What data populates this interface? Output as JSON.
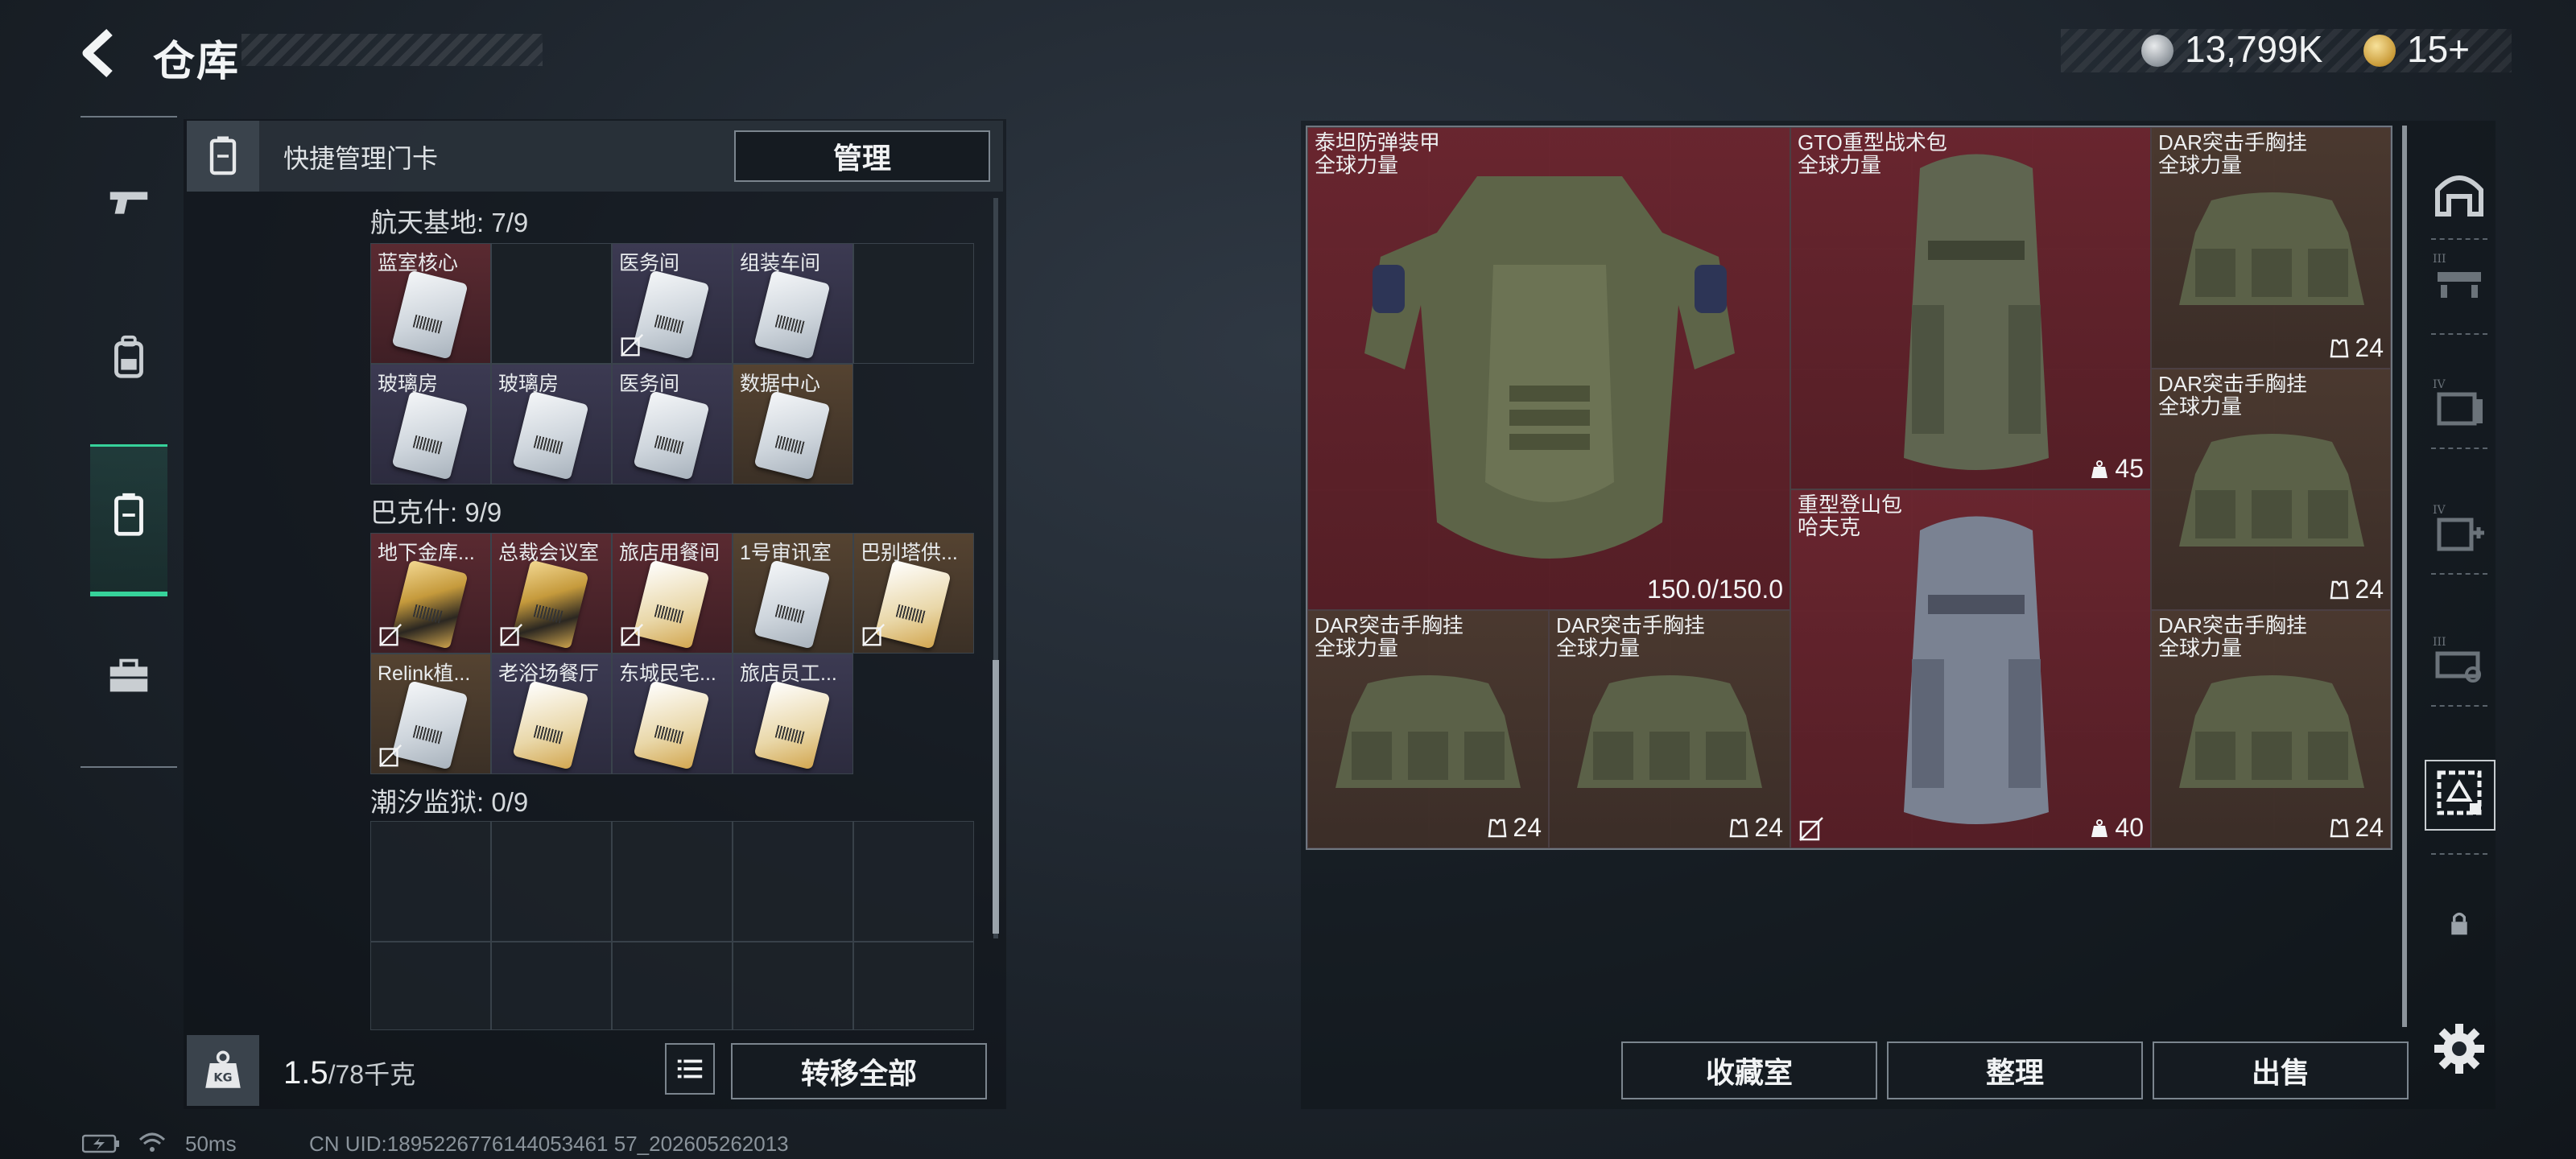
{
  "header": {
    "title": "仓库",
    "currency_silver": "13,799K",
    "currency_gold": "15+"
  },
  "sidebar": {
    "items": [
      {
        "name": "pistol",
        "icon": "pistol-icon"
      },
      {
        "name": "backpack",
        "icon": "backpack-icon"
      },
      {
        "name": "keycard",
        "icon": "keycard-icon",
        "active": true
      },
      {
        "name": "toolbox",
        "icon": "toolbox-icon"
      }
    ]
  },
  "left_panel": {
    "quick_manage_label": "快捷管理门卡",
    "manage_button": "管理",
    "sections": [
      {
        "label": "航天基地: 7/9",
        "cells": [
          {
            "name": "蓝室核心",
            "color": "red",
            "card": "white"
          },
          {
            "name": "",
            "color": "blank"
          },
          {
            "name": "医务间",
            "color": "purple",
            "card": "white",
            "unlinked": true
          },
          {
            "name": "组装车间",
            "color": "purple",
            "card": "white"
          },
          {
            "name": "",
            "color": "blank"
          },
          {
            "name": "玻璃房",
            "color": "purple",
            "card": "white"
          },
          {
            "name": "玻璃房",
            "color": "purple",
            "card": "white"
          },
          {
            "name": "医务间",
            "color": "purple",
            "card": "white"
          },
          {
            "name": "数据中心",
            "color": "gold",
            "card": "white"
          }
        ]
      },
      {
        "label": "巴克什: 9/9",
        "cells": [
          {
            "name": "地下金库...",
            "color": "red",
            "card": "gold",
            "unlinked": true
          },
          {
            "name": "总裁会议室",
            "color": "red",
            "card": "gold",
            "unlinked": true
          },
          {
            "name": "旅店用餐间",
            "color": "red",
            "card": "amber",
            "unlinked": true
          },
          {
            "name": "1号审讯室",
            "color": "gold",
            "card": "white"
          },
          {
            "name": "巴别塔供...",
            "color": "gold",
            "card": "amber",
            "unlinked": true
          },
          {
            "name": "Relink植...",
            "color": "gold",
            "card": "white",
            "unlinked": true
          },
          {
            "name": "老浴场餐厅",
            "color": "purple",
            "card": "amber"
          },
          {
            "name": "东城民宅...",
            "color": "purple",
            "card": "amber"
          },
          {
            "name": "旅店员工...",
            "color": "purple",
            "card": "amber"
          }
        ]
      },
      {
        "label": "潮汐监狱: 0/9",
        "cells": []
      }
    ],
    "weight_current": "1.5",
    "weight_max": "/78千克",
    "transfer_all_button": "转移全部"
  },
  "inventory": {
    "items": [
      {
        "id": "armor",
        "name": "泰坦防弹装甲",
        "sub": "全球力量",
        "stat": "150.0/150.0",
        "stat_icon": "",
        "color": "red"
      },
      {
        "id": "gto-pack",
        "name": "GTO重型战术包",
        "sub": "全球力量",
        "stat": "45",
        "stat_icon": "weight-icon",
        "color": "red"
      },
      {
        "id": "dar-1",
        "name": "DAR突击手胸挂",
        "sub": "全球力量",
        "stat": "24",
        "stat_icon": "vest-icon",
        "color": "brown"
      },
      {
        "id": "dar-2",
        "name": "DAR突击手胸挂",
        "sub": "全球力量",
        "stat": "24",
        "stat_icon": "vest-icon",
        "color": "brown"
      },
      {
        "id": "mountain-pack",
        "name": "重型登山包",
        "sub": "哈夫克",
        "stat": "40",
        "stat_icon": "weight-icon",
        "color": "red",
        "unlinked": true
      },
      {
        "id": "dar-3",
        "name": "DAR突击手胸挂",
        "sub": "全球力量",
        "stat": "24",
        "stat_icon": "vest-icon",
        "color": "brown"
      },
      {
        "id": "dar-4",
        "name": "DAR突击手胸挂",
        "sub": "全球力量",
        "stat": "24",
        "stat_icon": "vest-icon",
        "color": "brown"
      },
      {
        "id": "dar-5",
        "name": "DAR突击手胸挂",
        "sub": "全球力量",
        "stat": "24",
        "stat_icon": "vest-icon",
        "color": "brown"
      }
    ],
    "bottom_buttons": {
      "collection": "收藏室",
      "organize": "整理",
      "sell": "出售"
    }
  },
  "right_rail": {
    "items": [
      {
        "icon": "safehouse-icon"
      },
      {
        "icon": "weapon-bench-icon",
        "tier": "III"
      },
      {
        "icon": "storage-icon",
        "tier": "IV"
      },
      {
        "icon": "medical-icon",
        "tier": "IV"
      },
      {
        "icon": "workbench-icon",
        "tier": "III"
      },
      {
        "icon": "keycard-manage-icon",
        "active": true
      },
      {
        "icon": "lock-icon"
      },
      {
        "icon": "gear-icon"
      }
    ]
  },
  "status_bar": {
    "ping": "50ms",
    "uid": "CN UID:1895226776144053461 57_202605262013"
  }
}
